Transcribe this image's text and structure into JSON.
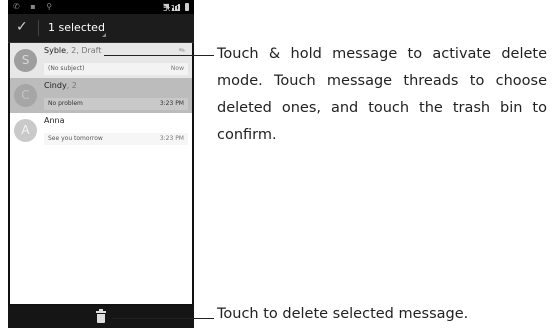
{
  "status_bar": {
    "time": "5:12",
    "ampm": "PM"
  },
  "action_bar": {
    "selected_label": "1 selected"
  },
  "messages": [
    {
      "avatar": "S",
      "name": "Syble",
      "count": ", 2",
      "draft": ", Draft",
      "snippet": "(No subject)",
      "time": "Now",
      "has_attachment": true
    },
    {
      "avatar": "C",
      "name": "Cindy",
      "count": ", 2",
      "draft": "",
      "snippet": "No problem",
      "time": "3:23 PM",
      "selected": true
    },
    {
      "avatar": "A",
      "name": "Anna",
      "count": "",
      "draft": "",
      "snippet": "See you tomorrow",
      "time": "3:23 PM"
    }
  ],
  "callouts": {
    "top": "Touch & hold message to activate delete mode. Touch message threads to choose deleted ones, and touch the trash bin to confirm.",
    "bottom": "Touch to delete selected message."
  },
  "icons": {
    "check": "check-icon",
    "trash": "trash-icon",
    "attachment": "paperclip-icon",
    "wifi": "wifi-icon",
    "signal": "signal-icon",
    "battery": "battery-icon"
  }
}
